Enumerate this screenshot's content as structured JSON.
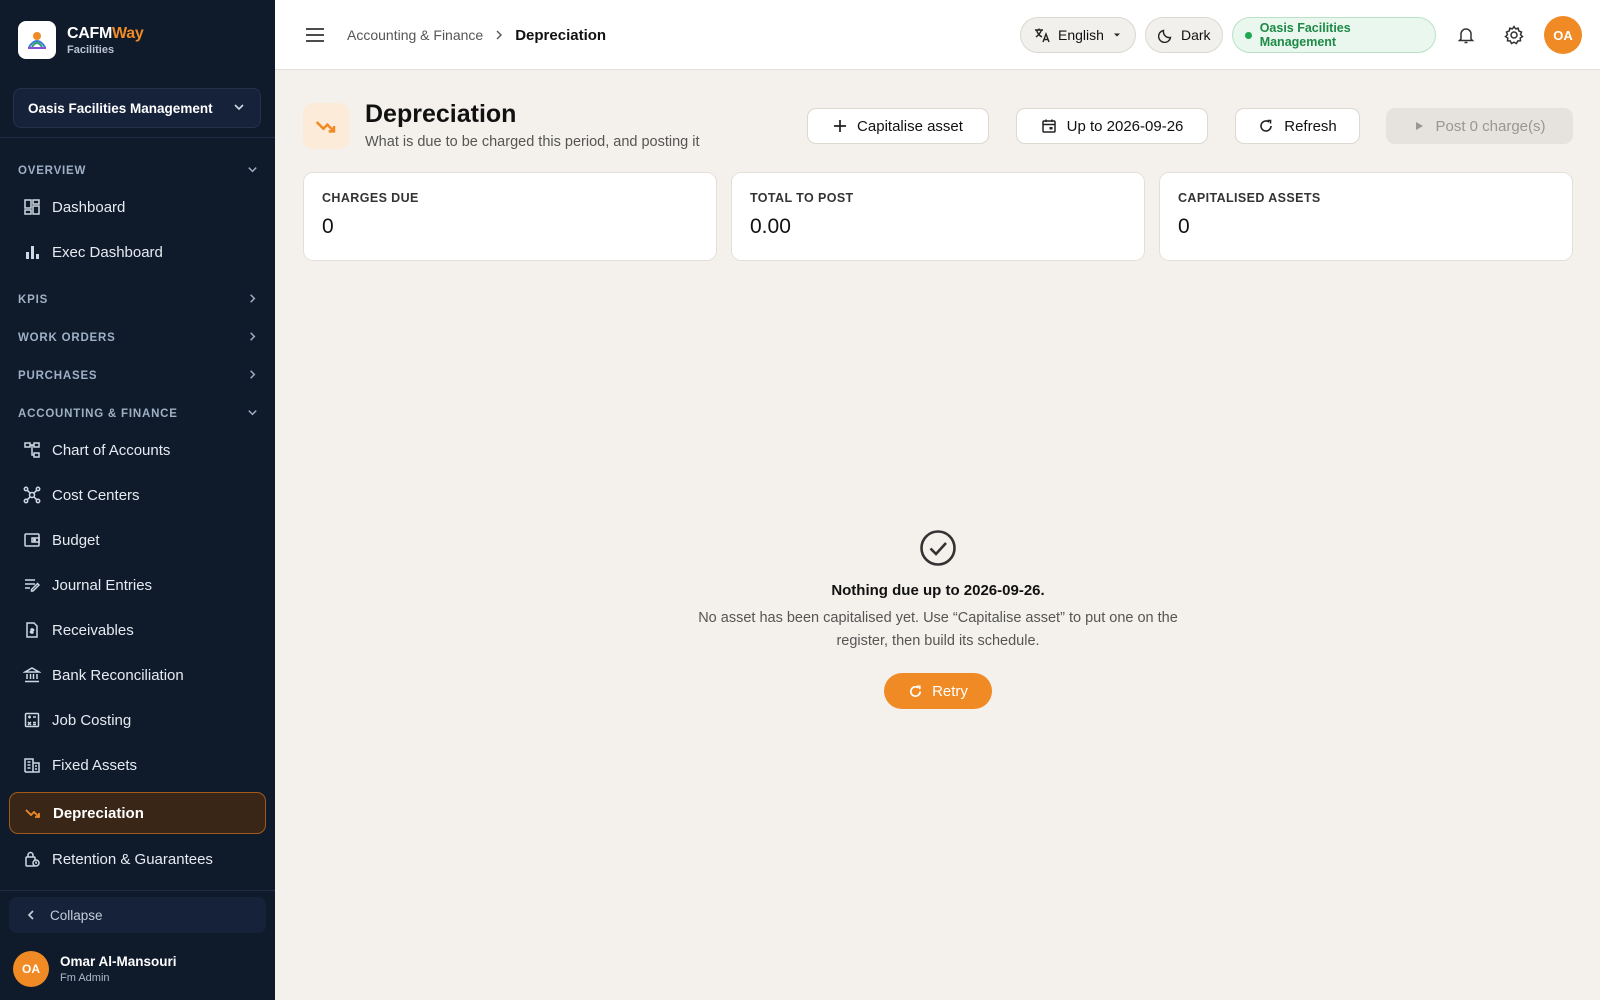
{
  "brand": {
    "name_main": "CAFM",
    "name_accent": "Way",
    "subtitle": "Facilities"
  },
  "sidebar": {
    "org": "Oasis Facilities Management",
    "sections": {
      "overview": "OVERVIEW",
      "kpis": "KPIS",
      "work_orders": "WORK ORDERS",
      "purchases": "PURCHASES",
      "accounting": "ACCOUNTING & FINANCE"
    },
    "items": {
      "dashboard": "Dashboard",
      "exec_dashboard": "Exec Dashboard",
      "chart_of_accounts": "Chart of Accounts",
      "cost_centers": "Cost Centers",
      "budget": "Budget",
      "journal_entries": "Journal Entries",
      "receivables": "Receivables",
      "bank_reconciliation": "Bank Reconciliation",
      "job_costing": "Job Costing",
      "fixed_assets": "Fixed Assets",
      "depreciation": "Depreciation",
      "retention": "Retention & Guarantees"
    },
    "collapse_label": "Collapse",
    "user": {
      "initials": "OA",
      "name": "Omar Al-Mansouri",
      "role": "Fm Admin"
    }
  },
  "topbar": {
    "breadcrumb_parent": "Accounting & Finance",
    "breadcrumb_current": "Depreciation",
    "language": "English",
    "theme": "Dark",
    "org_badge": "Oasis Facilities Management",
    "avatar_initials": "OA"
  },
  "page": {
    "title": "Depreciation",
    "subtitle": "What is due to be charged this period, and posting it",
    "actions": {
      "capitalise": "Capitalise asset",
      "date": "Up to 2026-09-26",
      "refresh": "Refresh",
      "post": "Post 0 charge(s)"
    },
    "stats": [
      {
        "label": "CHARGES DUE",
        "value": "0"
      },
      {
        "label": "TOTAL TO POST",
        "value": "0.00"
      },
      {
        "label": "CAPITALISED ASSETS",
        "value": "0"
      }
    ],
    "empty": {
      "title": "Nothing due up to 2026-09-26.",
      "description": "No asset has been capitalised yet. Use “Capitalise asset” to put one on the register, then build its schedule.",
      "retry": "Retry"
    }
  },
  "colors": {
    "accent": "#f08a24",
    "sidebar_bg": "#0f1a2b",
    "success": "#1e8a46"
  }
}
